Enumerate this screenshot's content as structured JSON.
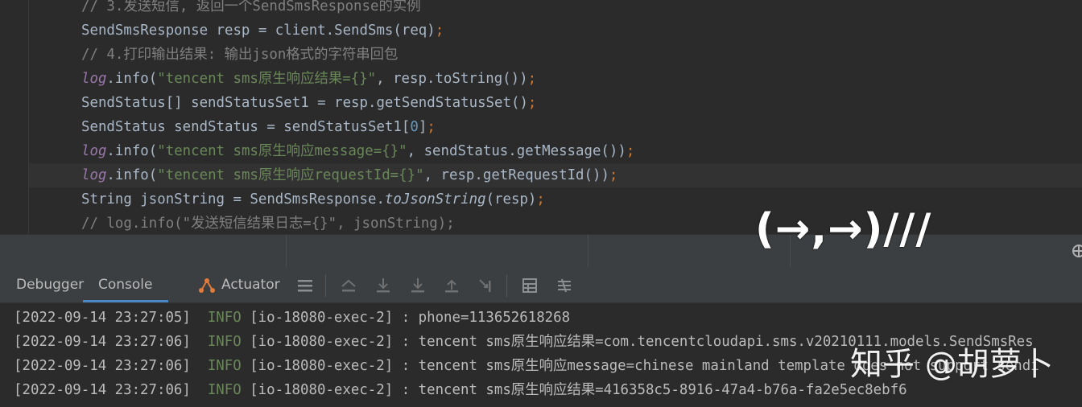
{
  "editor": {
    "lines": [
      [
        {
          "t": "// 3.发送短信, 返回一个SendSmsResponse的实例",
          "c": "comment"
        }
      ],
      [
        {
          "t": "SendSmsResponse resp = client.SendSms(req)",
          "c": "plain"
        },
        {
          "t": ";",
          "c": "kw"
        }
      ],
      [
        {
          "t": "// 4.打印输出结果: 输出json格式的字符串回包",
          "c": "comment"
        }
      ],
      [
        {
          "t": "log",
          "c": "field"
        },
        {
          "t": ".info(",
          "c": "plain"
        },
        {
          "t": "\"tencent sms原生响应结果={}\"",
          "c": "string"
        },
        {
          "t": ", resp.toString())",
          "c": "plain"
        },
        {
          "t": ";",
          "c": "kw"
        }
      ],
      [
        {
          "t": "SendStatus[] sendStatusSet1 = resp.getSendStatusSet()",
          "c": "plain"
        },
        {
          "t": ";",
          "c": "kw"
        }
      ],
      [
        {
          "t": "SendStatus sendStatus = sendStatusSet1[",
          "c": "plain"
        },
        {
          "t": "0",
          "c": "num"
        },
        {
          "t": "]",
          "c": "plain"
        },
        {
          "t": ";",
          "c": "kw"
        }
      ],
      [
        {
          "t": "log",
          "c": "field"
        },
        {
          "t": ".info(",
          "c": "plain"
        },
        {
          "t": "\"tencent sms原生响应message={}\"",
          "c": "string"
        },
        {
          "t": ", sendStatus.getMessage())",
          "c": "plain"
        },
        {
          "t": ";",
          "c": "kw"
        }
      ],
      [
        {
          "t": "log",
          "c": "field"
        },
        {
          "t": ".info(",
          "c": "plain"
        },
        {
          "t": "\"tencent sms原生响应requestId={}\"",
          "c": "string"
        },
        {
          "t": ", resp.getRequestId())",
          "c": "plain"
        },
        {
          "t": ";",
          "c": "kw"
        }
      ],
      [
        {
          "t": "String jsonString = SendSmsResponse.",
          "c": "plain"
        },
        {
          "t": "toJsonString",
          "c": "static"
        },
        {
          "t": "(resp)",
          "c": "plain"
        },
        {
          "t": ";",
          "c": "kw"
        }
      ],
      [
        {
          "t": "// log.info(\"发送短信结果日志={}\", jsonString);",
          "c": "comment"
        }
      ]
    ]
  },
  "tabs": {
    "debugger": "Debugger",
    "console": "Console",
    "actuator": "Actuator"
  },
  "console": {
    "lines": [
      {
        "ts": "[2022-09-14 23:27:05]",
        "level": "INFO",
        "thread": "[io-18080-exec-2]",
        "msg": ": phone=113652618268"
      },
      {
        "ts": "[2022-09-14 23:27:06]",
        "level": "INFO",
        "thread": "[io-18080-exec-2]",
        "msg": ": tencent sms原生响应结果=com.tencentcloudapi.sms.v20210111.models.SendSmsRes"
      },
      {
        "ts": "[2022-09-14 23:27:06]",
        "level": "INFO",
        "thread": "[io-18080-exec-2]",
        "msg": ": tencent sms原生响应message=chinese mainland template does not support sendi"
      },
      {
        "ts": "[2022-09-14 23:27:06]",
        "level": "INFO",
        "thread": "[io-18080-exec-2]",
        "msg": ": tencent sms原生响应结果=416358c5-8916-47a4-b76a-fa2e5ec8ebf6"
      }
    ]
  },
  "overlay": {
    "face_text": "(→,→)///",
    "watermark": "知乎 @胡萝卜"
  },
  "icons": {
    "actuator": "actuator-icon",
    "gear": "gear-icon"
  }
}
